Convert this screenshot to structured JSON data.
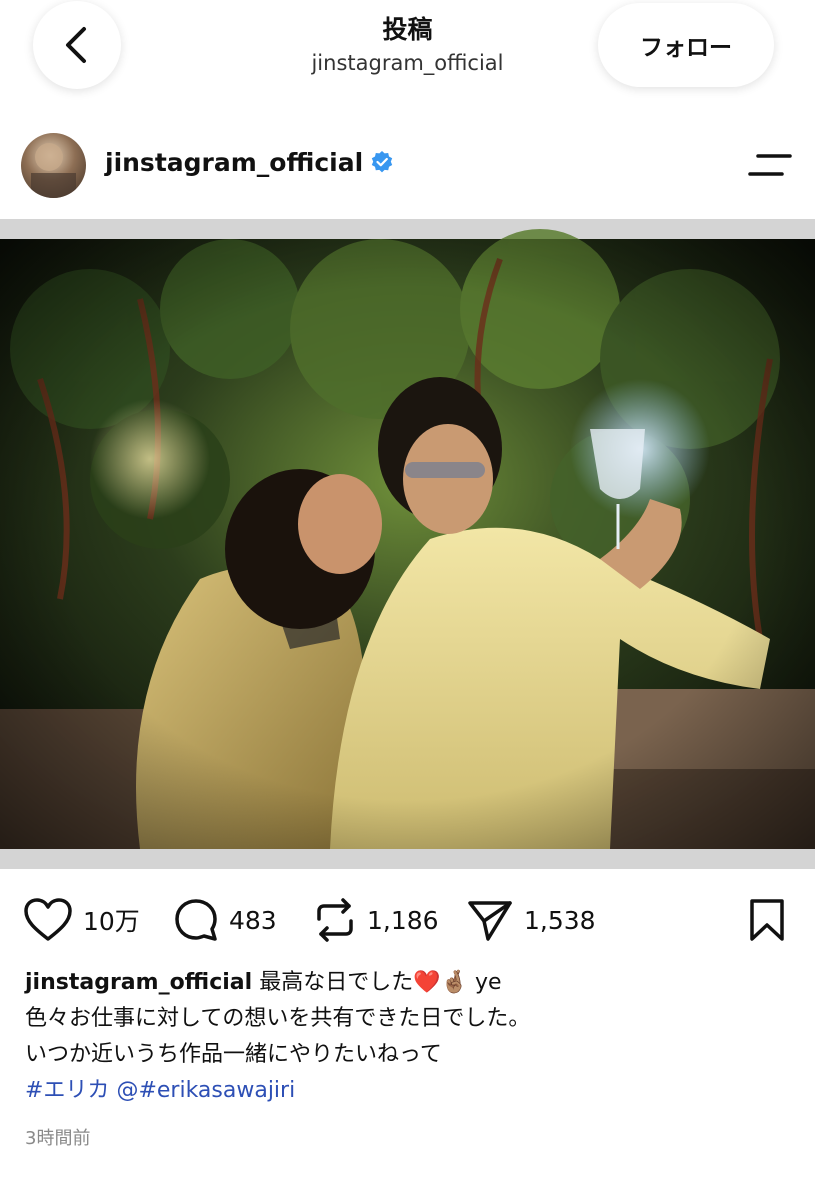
{
  "header": {
    "title": "投稿",
    "subtitle": "jinstagram_official",
    "follow_label": "フォロー",
    "back_icon": "chevron-left-icon"
  },
  "profile": {
    "username": "jinstagram_official",
    "verified_icon": "verified-badge-icon",
    "menu_icon": "menu-icon"
  },
  "actions": {
    "likes": "10万",
    "comments": "483",
    "reposts": "1,186",
    "shares": "1,538",
    "icons": [
      "heart-icon",
      "comment-icon",
      "repost-icon",
      "send-icon",
      "bookmark-icon"
    ]
  },
  "caption": {
    "username": "jinstagram_official",
    "line1": "最高な日でした❤️🤞🏽 ye",
    "line2": "色々お仕事に対しての想いを共有できた日でした。",
    "line3": "いつか近いうち作品一緒にやりたいねって",
    "hashtag": "#エリカ",
    "mention": "@#erikasawajiri"
  },
  "timestamp": "3時間前",
  "colors": {
    "link": "#2d4fb5",
    "verified": "#3897f0",
    "muted": "#8a8a8a"
  }
}
